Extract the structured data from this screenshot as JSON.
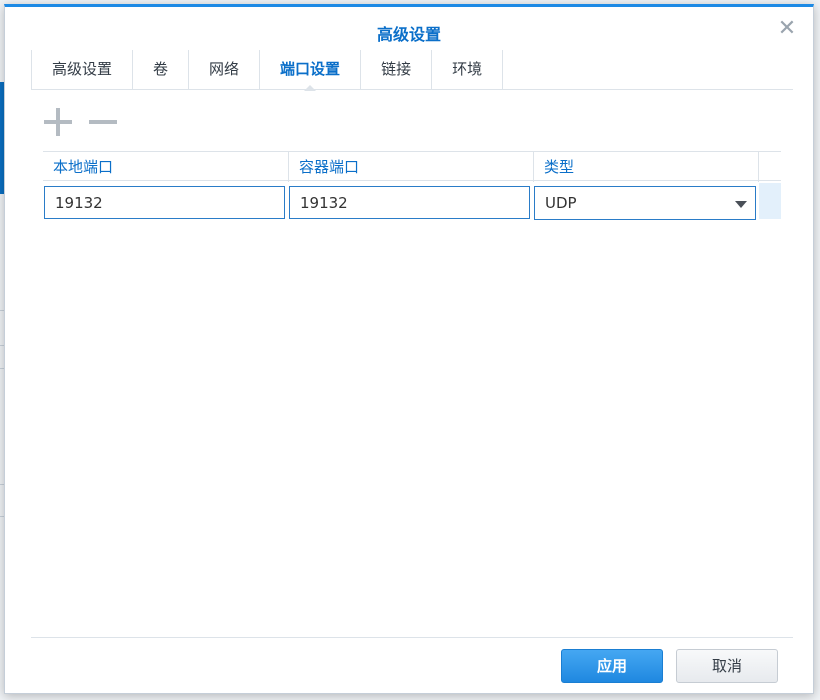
{
  "dialog": {
    "title": "高级设置",
    "close_icon": "close-icon"
  },
  "tabs": [
    {
      "label": "高级设置",
      "active": false
    },
    {
      "label": "卷",
      "active": false
    },
    {
      "label": "网络",
      "active": false
    },
    {
      "label": "端口设置",
      "active": true
    },
    {
      "label": "链接",
      "active": false
    },
    {
      "label": "环境",
      "active": false
    }
  ],
  "toolbar": {
    "add_icon": "plus-icon",
    "remove_icon": "minus-icon"
  },
  "grid": {
    "columns": [
      "本地端口",
      "容器端口",
      "类型"
    ],
    "rows": [
      {
        "local_port": "19132",
        "container_port": "19132",
        "type": "UDP"
      }
    ]
  },
  "footer": {
    "apply_label": "应用",
    "cancel_label": "取消"
  },
  "colors": {
    "accent": "#0b6fc9",
    "primary_button": "#1f88e0"
  }
}
